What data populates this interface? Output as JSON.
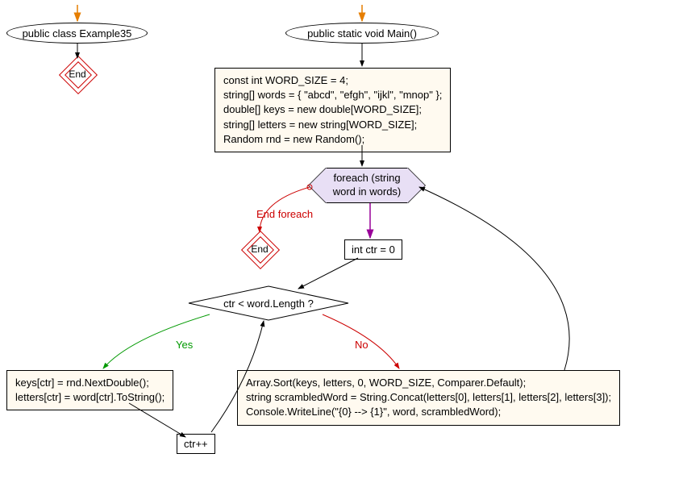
{
  "nodes": {
    "class_ellipse": "public class Example35",
    "end1": "End",
    "main_ellipse": "public static void Main()",
    "init_box": "const int WORD_SIZE = 4;\nstring[] words = { \"abcd\", \"efgh\", \"ijkl\", \"mnop\" };\ndouble[] keys = new double[WORD_SIZE];\nstring[] letters = new string[WORD_SIZE];\nRandom rnd = new Random();",
    "foreach_hex": "foreach (string\nword in words)",
    "end2": "End",
    "ctr_box": "int ctr = 0",
    "decision": "ctr < word.Length ?",
    "yes_box": "keys[ctr] = rnd.NextDouble();\nletters[ctr] = word[ctr].ToString();",
    "incr_box": "ctr++",
    "no_box": "Array.Sort(keys, letters, 0, WORD_SIZE, Comparer.Default);\nstring scrambledWord = String.Concat(letters[0], letters[1], letters[2], letters[3]);\nConsole.WriteLine(\"{0} --> {1}\", word, scrambledWord);"
  },
  "edges": {
    "end_foreach": "End foreach",
    "yes": "Yes",
    "no": "No"
  }
}
